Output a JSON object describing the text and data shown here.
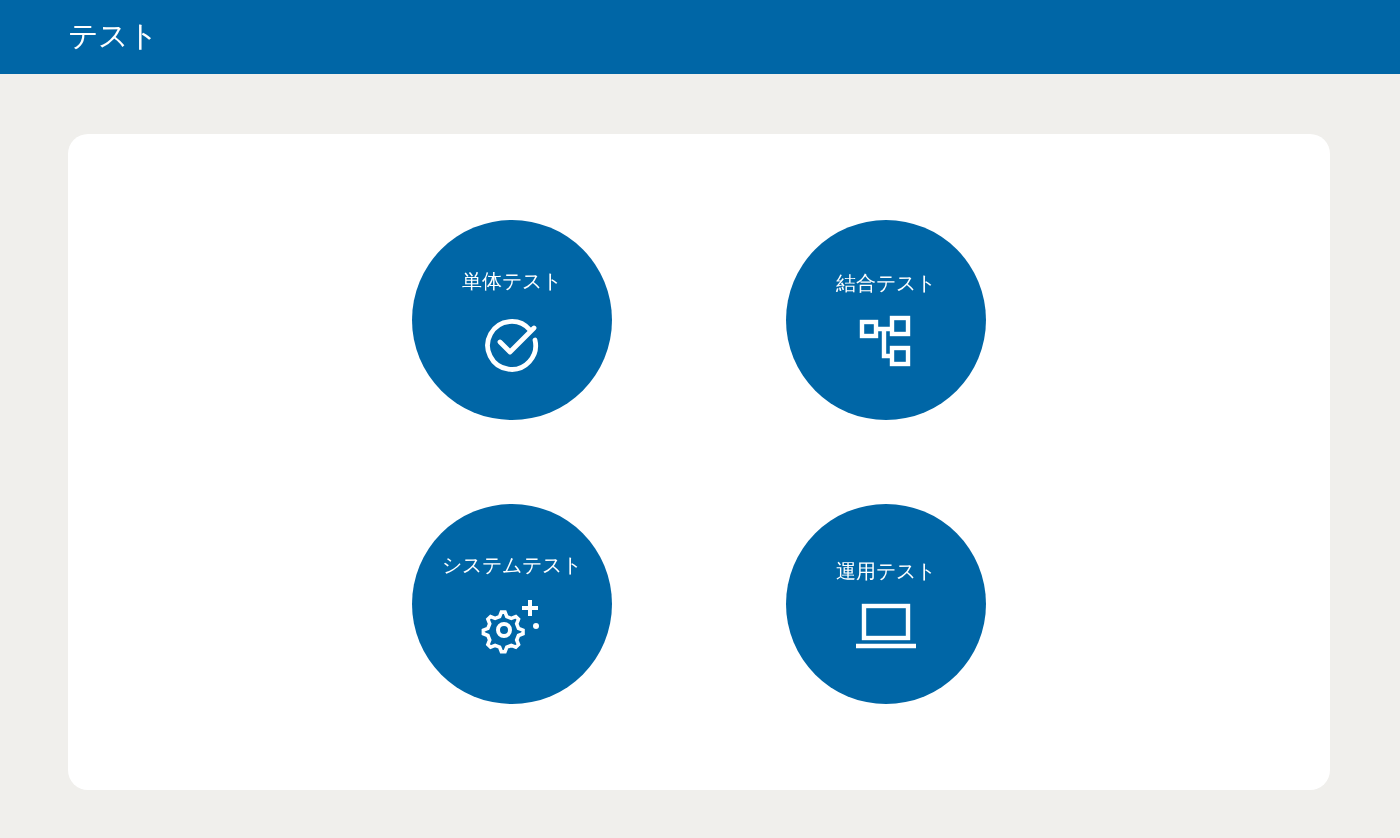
{
  "header": {
    "title": "テスト"
  },
  "tests": [
    {
      "label": "単体テスト",
      "kind": "check"
    },
    {
      "label": "結合テスト",
      "kind": "hierarchy"
    },
    {
      "label": "システムテスト",
      "kind": "gear"
    },
    {
      "label": "運用テスト",
      "kind": "laptop"
    }
  ]
}
